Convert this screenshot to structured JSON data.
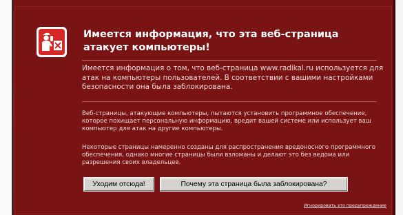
{
  "warning": {
    "title": "Имеется информация, что эта веб-страница атакует компьютеры!",
    "info": "Имеется информация о том, что веб-страница www.radikal.ru используется для атак на компьютеры пользователей. В соответствии с вашими настройками безопасности она была заблокирована.",
    "paragraph1": "Веб-страницы, атакующие компьютеры, пытаются установить программное обеспечение, которое похищает персональную информацию, вредит вашей системе или использует ваш компьютер для атак на другие компьютеры.",
    "paragraph2": "Некоторые страницы намеренно созданы для распространения вредоносного программного обеспечения, однако многие страницы были взломаны и делают это без ведома или разрешения своих владельцев.",
    "buttons": {
      "get_out": "Уходим отсюда!",
      "why_blocked": "Почему эта страница была заблокирована?"
    },
    "ignore_link": "Игнорировать это предупреждение",
    "icon": "police-officer-icon"
  },
  "colors": {
    "background": "#7a1313",
    "icon_red": "#d72828",
    "text": "#ffffff",
    "button": "#d6d3ce"
  }
}
